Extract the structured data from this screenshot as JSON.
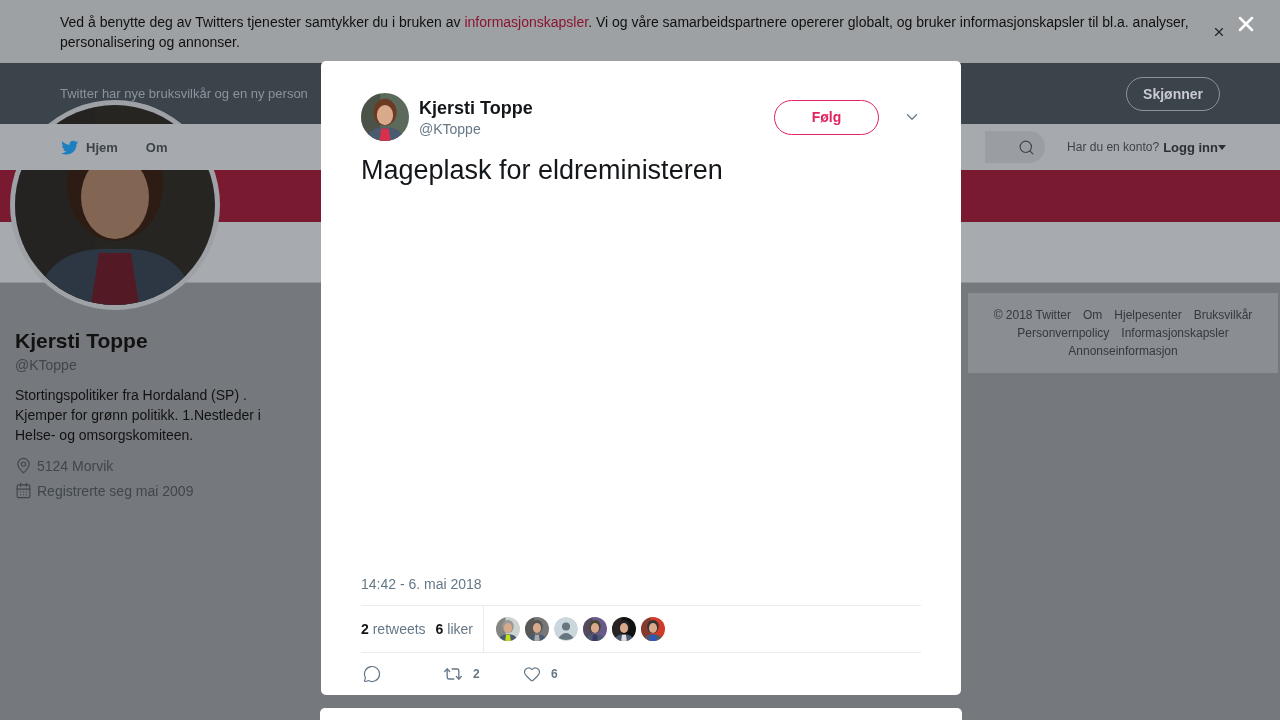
{
  "cookie_banner": {
    "text_before": "Ved å benytte deg av Twitters tjenester samtykker du i bruken av ",
    "link": "informasjonskapsler",
    "text_after": ". Vi og våre samarbeidspartnere opererer globalt, og bruker informasjonskapsler til bl.a. analyser, personalisering og annonser."
  },
  "terms_notice": {
    "text": "Twitter har nye bruksvilkår og en ny person",
    "button": "Skjønner"
  },
  "nav": {
    "items": [
      {
        "label": "Hjem",
        "kind": "home"
      },
      {
        "label": "Om",
        "kind": "plain"
      }
    ],
    "login_prompt": "Har du en konto?",
    "login_link": "Logg inn"
  },
  "profile": {
    "name": "Kjersti Toppe",
    "handle": "@KToppe",
    "bio": "Stortingspolitiker fra Hordaland (SP) . Kjemper for grønn politikk. 1.Nestleder i Helse- og omsorgskomiteen.",
    "location": "5124 Morvik",
    "joined": "Registrerte seg mai 2009"
  },
  "footer_links": [
    "© 2018 Twitter",
    "Om",
    "Hjelpesenter",
    "Bruksvilkår",
    "Personvernpolicy",
    "Informasjonskapsler",
    "Annonseinformasjon"
  ],
  "tweet": {
    "name": "Kjersti Toppe",
    "handle": "@KToppe",
    "follow_button": "Følg",
    "text": "Mageplask for eldreministeren",
    "timestamp": "14:42 - 6. mai 2018",
    "stats": [
      {
        "count": "2",
        "label": "retweets"
      },
      {
        "count": "6",
        "label": "liker"
      }
    ],
    "liker_avatars": [
      {
        "kind": "picture"
      },
      {
        "kind": "picture"
      },
      {
        "kind": "default"
      },
      {
        "kind": "picture"
      },
      {
        "kind": "picture"
      },
      {
        "kind": "picture"
      }
    ],
    "actions": [
      {
        "kind": "reply"
      },
      {
        "kind": "retweet",
        "count": "2"
      },
      {
        "kind": "like",
        "count": "6"
      }
    ]
  }
}
